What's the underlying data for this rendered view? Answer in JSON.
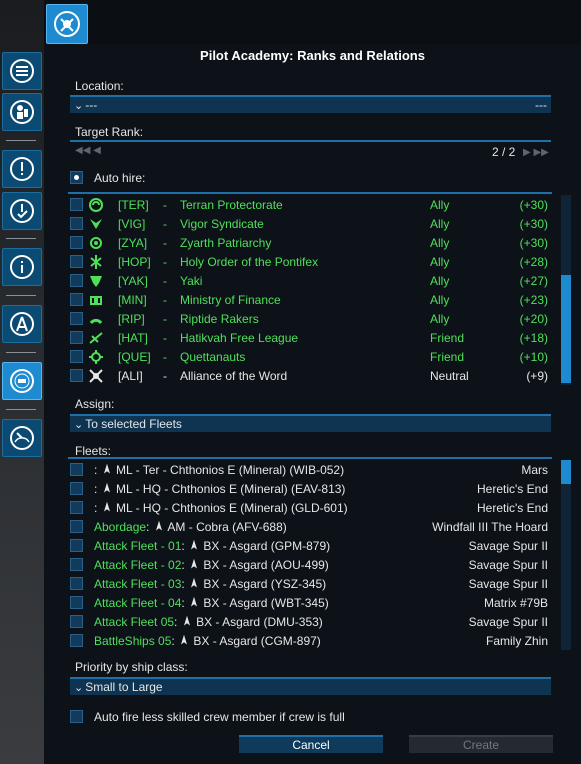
{
  "title": "Pilot Academy: Ranks and Relations",
  "location": {
    "label": "Location:",
    "value": "---",
    "right": "---"
  },
  "target_rank": {
    "label": "Target Rank:",
    "page": "2 / 2"
  },
  "auto_hire": {
    "label": "Auto hire:",
    "checked": true
  },
  "factions": [
    {
      "tag": "[TER]",
      "dash": "-",
      "name": "Terran Protectorate",
      "relation": "Ally",
      "score": "(+30)",
      "color": "green",
      "icon": "ter-faction-icon"
    },
    {
      "tag": "[VIG]",
      "dash": "-",
      "name": "Vigor Syndicate",
      "relation": "Ally",
      "score": "(+30)",
      "color": "green",
      "icon": "vig-faction-icon"
    },
    {
      "tag": "[ZYA]",
      "dash": "-",
      "name": "Zyarth Patriarchy",
      "relation": "Ally",
      "score": "(+30)",
      "color": "green",
      "icon": "zya-faction-icon"
    },
    {
      "tag": "[HOP]",
      "dash": "-",
      "name": "Holy Order of the Pontifex",
      "relation": "Ally",
      "score": "(+28)",
      "color": "green",
      "icon": "hop-faction-icon"
    },
    {
      "tag": "[YAK]",
      "dash": "-",
      "name": "Yaki",
      "relation": "Ally",
      "score": "(+27)",
      "color": "green",
      "icon": "yak-faction-icon"
    },
    {
      "tag": "[MIN]",
      "dash": "-",
      "name": "Ministry of Finance",
      "relation": "Ally",
      "score": "(+23)",
      "color": "green",
      "icon": "min-faction-icon"
    },
    {
      "tag": "[RIP]",
      "dash": "-",
      "name": "Riptide Rakers",
      "relation": "Ally",
      "score": "(+20)",
      "color": "green",
      "icon": "rip-faction-icon"
    },
    {
      "tag": "[HAT]",
      "dash": "-",
      "name": "Hatikvah Free League",
      "relation": "Friend",
      "score": "(+18)",
      "color": "green",
      "icon": "hat-faction-icon"
    },
    {
      "tag": "[QUE]",
      "dash": "-",
      "name": "Quettanauts",
      "relation": "Friend",
      "score": "(+10)",
      "color": "green",
      "icon": "que-faction-icon"
    },
    {
      "tag": "[ALI]",
      "dash": "-",
      "name": "Alliance of the Word",
      "relation": "Neutral",
      "score": "(+9)",
      "color": "white",
      "icon": "ali-faction-icon"
    }
  ],
  "assign": {
    "label": "Assign:",
    "value": "To selected Fleets"
  },
  "fleets_label": "Fleets:",
  "fleets": [
    {
      "prefix": "",
      "sep": ":",
      "ship": "ML - Ter - Chthonios E (Mineral) (WIB-052)",
      "location": "Mars",
      "green": false,
      "icon": "ship-ml-icon"
    },
    {
      "prefix": "",
      "sep": ":",
      "ship": "ML - HQ - Chthonios E (Mineral) (EAV-813)",
      "location": "Heretic's End",
      "green": false,
      "icon": "ship-ml-icon"
    },
    {
      "prefix": "",
      "sep": ":",
      "ship": "ML - HQ - Chthonios E (Mineral) (GLD-601)",
      "location": "Heretic's End",
      "green": false,
      "icon": "ship-ml-icon"
    },
    {
      "prefix": "Abordage",
      "sep": ":",
      "ship": "AM - Cobra (AFV-688)",
      "location": "Windfall III The Hoard",
      "green": true,
      "icon": "ship-am-icon"
    },
    {
      "prefix": "Attack Fleet - 01",
      "sep": ":",
      "ship": "BX - Asgard (GPM-879)",
      "location": "Savage Spur II",
      "green": true,
      "icon": "ship-bx-icon"
    },
    {
      "prefix": "Attack Fleet - 02",
      "sep": ":",
      "ship": "BX - Asgard (AOU-499)",
      "location": "Savage Spur II",
      "green": true,
      "icon": "ship-bx-icon"
    },
    {
      "prefix": "Attack Fleet - 03",
      "sep": ":",
      "ship": "BX - Asgard (YSZ-345)",
      "location": "Savage Spur II",
      "green": true,
      "icon": "ship-bx-icon"
    },
    {
      "prefix": "Attack Fleet - 04",
      "sep": ":",
      "ship": "BX - Asgard (WBT-345)",
      "location": "Matrix #79B",
      "green": true,
      "icon": "ship-bx-icon"
    },
    {
      "prefix": "Attack Fleet 05",
      "sep": ":",
      "ship": "BX - Asgard (DMU-353)",
      "location": "Savage Spur II",
      "green": true,
      "icon": "ship-bx-icon"
    },
    {
      "prefix": "BattleShips 05",
      "sep": ":",
      "ship": "BX - Asgard (CGM-897)",
      "location": "Family Zhin",
      "green": true,
      "icon": "ship-bx-icon"
    }
  ],
  "priority": {
    "label": "Priority by ship class:",
    "value": "Small to Large"
  },
  "auto_fire": {
    "label": "Auto fire less skilled crew member if crew is full",
    "checked": false
  },
  "buttons": {
    "cancel": "Cancel",
    "create": "Create"
  },
  "colors": {
    "accent": "#1e8bd0",
    "green": "#4fe05a",
    "panel": "#0d1218"
  }
}
